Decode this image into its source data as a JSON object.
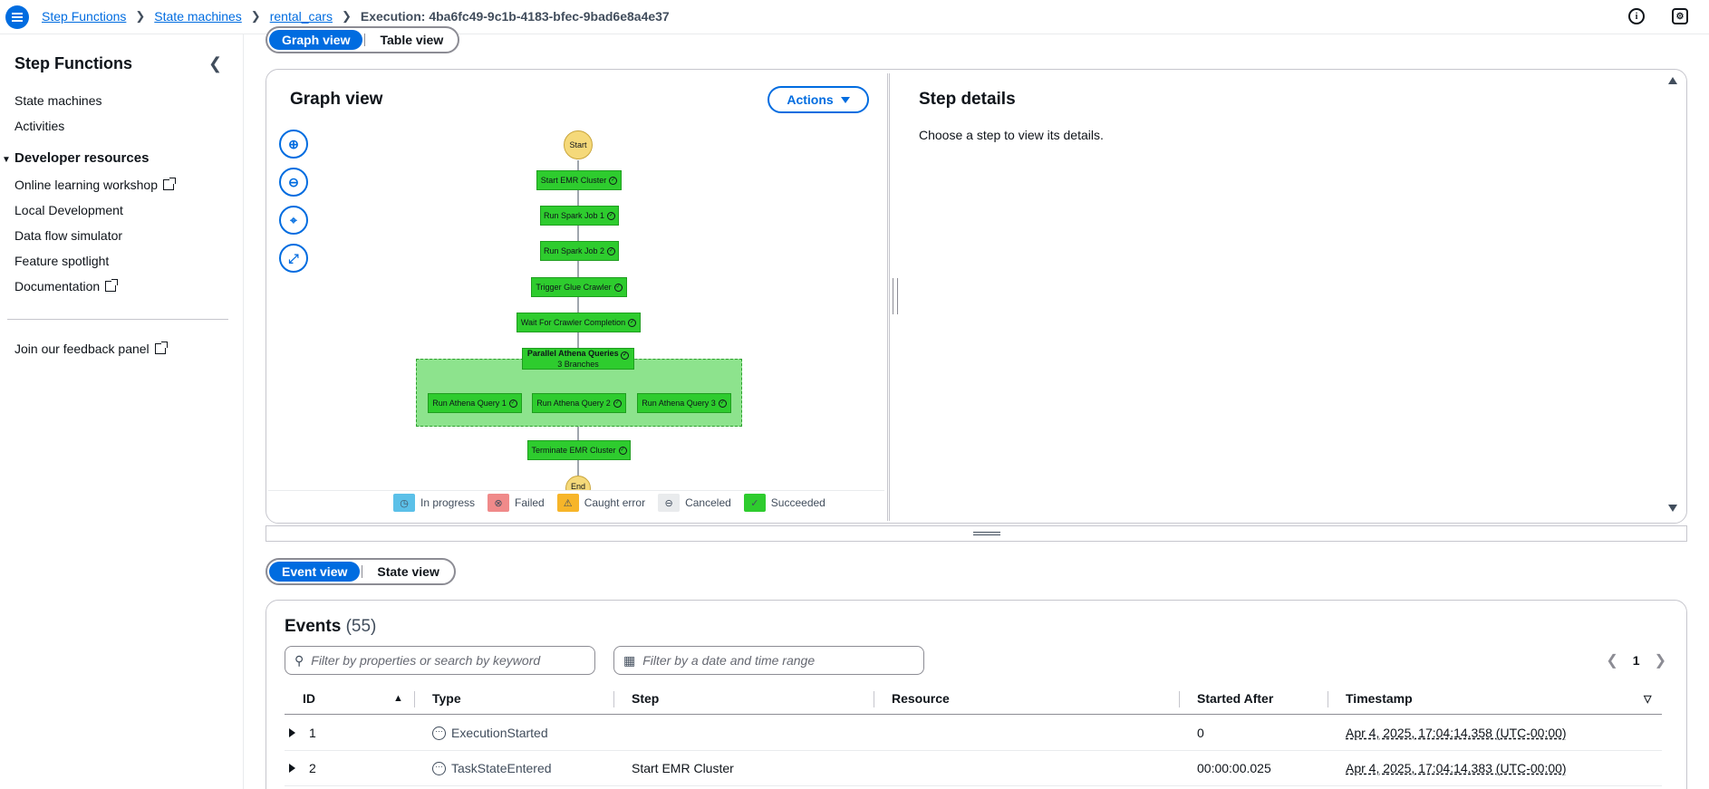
{
  "breadcrumb": {
    "items": [
      "Step Functions",
      "State machines",
      "rental_cars"
    ],
    "current": "Execution: 4ba6fc49-9c1b-4183-bfec-9bad6e8a4e37"
  },
  "sidebar": {
    "title": "Step Functions",
    "links": [
      "State machines",
      "Activities"
    ],
    "section_title": "Developer resources",
    "section_links": [
      "Online learning workshop",
      "Local Development",
      "Data flow simulator",
      "Feature spotlight",
      "Documentation"
    ],
    "feedback": "Join our feedback panel"
  },
  "view_toggle": {
    "graph": "Graph view",
    "table": "Table view"
  },
  "graph": {
    "title": "Graph view",
    "actions_label": "Actions",
    "nodes": {
      "start": "Start",
      "start_emr": "Start EMR Cluster",
      "spark1": "Run Spark Job 1",
      "spark2": "Run Spark Job 2",
      "glue": "Trigger Glue Crawler",
      "wait": "Wait For Crawler Completion",
      "parallel": "Parallel Athena Queries",
      "parallel_sub": "3 Branches",
      "athena1": "Run Athena Query 1",
      "athena2": "Run Athena Query 2",
      "athena3": "Run Athena Query 3",
      "terminate": "Terminate EMR Cluster",
      "end": "End"
    },
    "legend": [
      "In progress",
      "Failed",
      "Caught error",
      "Canceled",
      "Succeeded"
    ],
    "legend_colors": {
      "in_progress": "#5bc0e8",
      "failed": "#f08a8a",
      "caught": "#f7b529",
      "canceled": "#e9ebed",
      "succeeded": "#2ecc2e"
    }
  },
  "step_details": {
    "title": "Step details",
    "text": "Choose a step to view its details."
  },
  "event_toggle": {
    "event": "Event view",
    "state": "State view"
  },
  "events": {
    "title": "Events",
    "count": "(55)",
    "filter_placeholder": "Filter by properties or search by keyword",
    "date_placeholder": "Filter by a date and time range",
    "page": "1",
    "columns": [
      "ID",
      "Type",
      "Step",
      "Resource",
      "Started After",
      "Timestamp"
    ],
    "rows": [
      {
        "id": "1",
        "type": "ExecutionStarted",
        "step": "",
        "resource": "",
        "started_after": "0",
        "timestamp": "Apr 4, 2025, 17:04:14.358 (UTC-00:00)"
      },
      {
        "id": "2",
        "type": "TaskStateEntered",
        "step": "Start EMR Cluster",
        "resource": "",
        "started_after": "00:00:00.025",
        "timestamp": "Apr 4, 2025, 17:04:14.383 (UTC-00:00)"
      }
    ]
  }
}
